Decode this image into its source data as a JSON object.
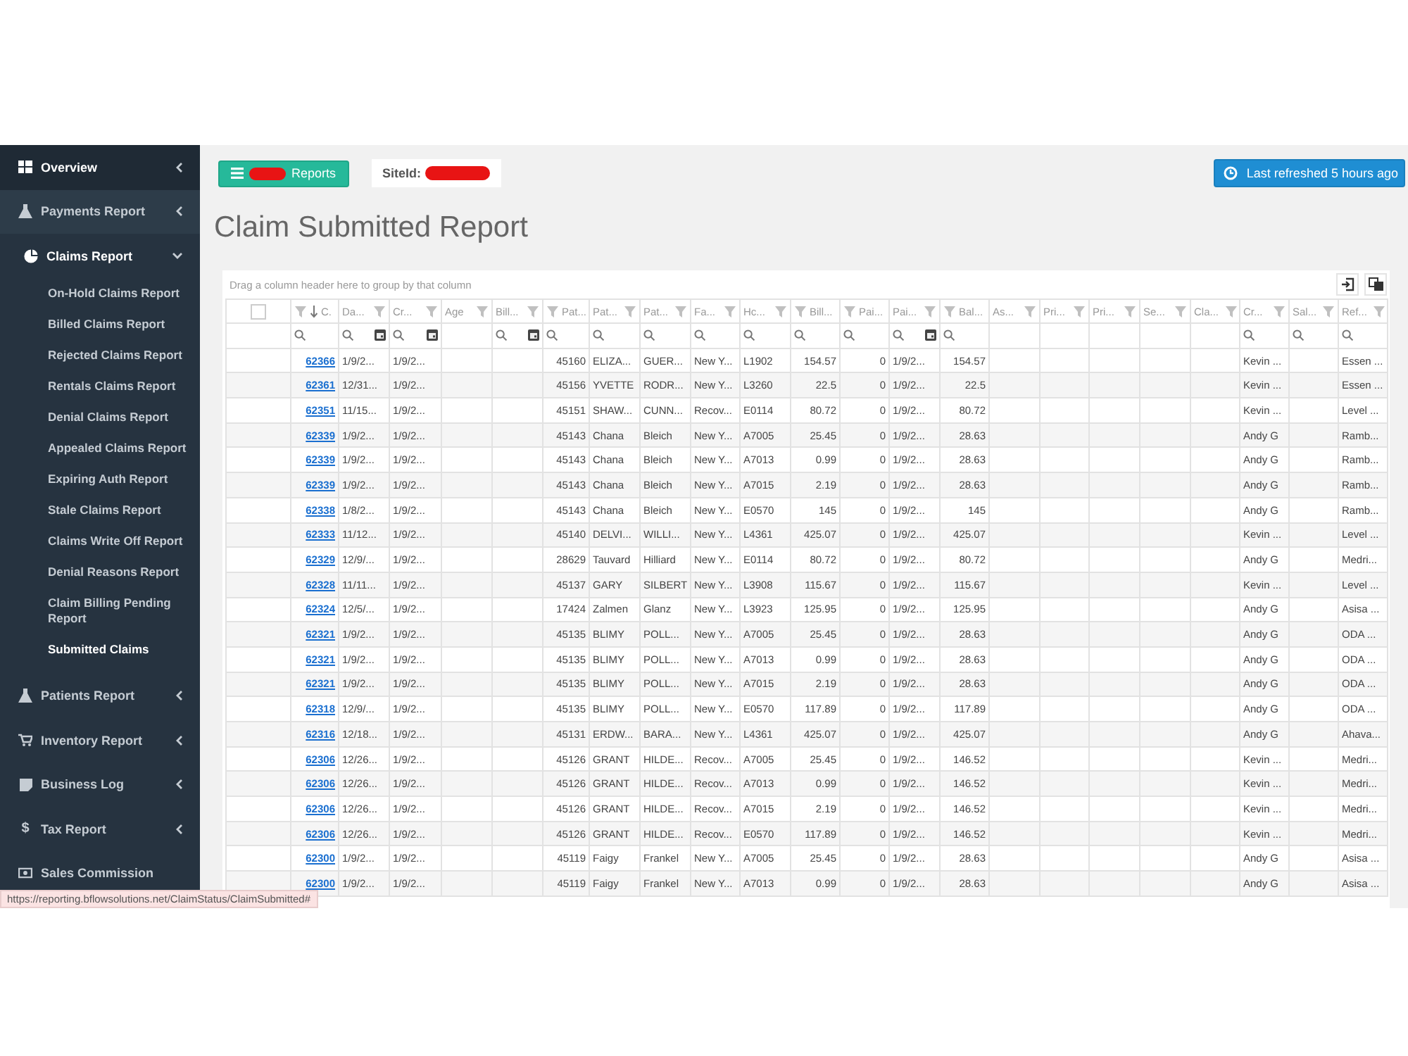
{
  "sidebar": {
    "items": [
      {
        "label": "Overview",
        "expanded": false
      },
      {
        "label": "Payments Report",
        "expanded": false
      },
      {
        "label": "Claims Report",
        "expanded": true,
        "children": [
          {
            "label": "On-Hold Claims Report",
            "selected": false
          },
          {
            "label": "Billed Claims Report",
            "selected": false
          },
          {
            "label": "Rejected Claims Report",
            "selected": false
          },
          {
            "label": "Rentals Claims Report",
            "selected": false
          },
          {
            "label": "Denial Claims Report",
            "selected": false
          },
          {
            "label": "Appealed Claims Report",
            "selected": false
          },
          {
            "label": "Expiring Auth Report",
            "selected": false
          },
          {
            "label": "Stale Claims Report",
            "selected": false
          },
          {
            "label": "Claims Write Off Report",
            "selected": false
          },
          {
            "label": "Denial Reasons Report",
            "selected": false
          },
          {
            "label": "Claim Billing Pending Report",
            "selected": false
          },
          {
            "label": "Submitted Claims",
            "selected": true
          }
        ]
      },
      {
        "label": "Patients Report",
        "expanded": false
      },
      {
        "label": "Inventory Report",
        "expanded": false
      },
      {
        "label": "Business Log",
        "expanded": false
      },
      {
        "label": "Tax Report",
        "glyph": "$",
        "expanded": false
      },
      {
        "label": "Sales Commission"
      }
    ]
  },
  "toolbar": {
    "reports_button": {
      "label": "Reports",
      "redacted": true
    },
    "site_id": {
      "label": "SiteId:",
      "redacted": true
    },
    "refresh_button": {
      "label": "Last refreshed 5 hours ago"
    }
  },
  "title": "Claim Submitted Report",
  "grid": {
    "group_panel": "Drag a column header here to group by that column",
    "columns": [
      {
        "kind": "checkbox",
        "checked": false
      },
      {
        "label": "C.",
        "kind": "link",
        "sorted": true,
        "filterable": true
      },
      {
        "label": "Da...",
        "kind": "date",
        "sorted": false,
        "filterable": true
      },
      {
        "label": "Cr...",
        "kind": "date",
        "sorted": false,
        "filterable": true
      },
      {
        "label": "Age",
        "kind": "text",
        "sorted": false,
        "filterable": false
      },
      {
        "label": "Bill...",
        "kind": "date",
        "sorted": false,
        "filterable": true
      },
      {
        "label": "Pat...",
        "kind": "number",
        "sorted": false,
        "filterable": true
      },
      {
        "label": "Pat...",
        "kind": "text",
        "sorted": false,
        "filterable": true
      },
      {
        "label": "Pat...",
        "kind": "text",
        "sorted": false,
        "filterable": true
      },
      {
        "label": "Fa...",
        "kind": "text",
        "sorted": false,
        "filterable": true
      },
      {
        "label": "Hc...",
        "kind": "text",
        "sorted": false,
        "filterable": true
      },
      {
        "label": "Bill...",
        "kind": "number",
        "sorted": false,
        "filterable": true
      },
      {
        "label": "Pai...",
        "kind": "number",
        "sorted": false,
        "filterable": true
      },
      {
        "label": "Pai...",
        "kind": "date",
        "sorted": false,
        "filterable": true
      },
      {
        "label": "Bal...",
        "kind": "number",
        "sorted": false,
        "filterable": true
      },
      {
        "label": "As...",
        "kind": "text",
        "sorted": false,
        "filterable": false
      },
      {
        "label": "Pri...",
        "kind": "text",
        "sorted": false,
        "filterable": false
      },
      {
        "label": "Pri...",
        "kind": "text",
        "sorted": false,
        "filterable": false
      },
      {
        "label": "Se...",
        "kind": "text",
        "sorted": false,
        "filterable": false
      },
      {
        "label": "Cla...",
        "kind": "text",
        "sorted": false,
        "filterable": false
      },
      {
        "label": "Cr...",
        "kind": "text",
        "sorted": false,
        "filterable": true
      },
      {
        "label": "Sal...",
        "kind": "text",
        "sorted": false,
        "filterable": true
      },
      {
        "label": "Ref...",
        "kind": "text",
        "sorted": false,
        "filterable": true
      }
    ],
    "rows": [
      [
        null,
        "62366",
        "1/9/2...",
        "1/9/2...",
        null,
        null,
        "45160",
        "ELIZA...",
        "GUER...",
        "New Y...",
        "L1902",
        "154.57",
        "0",
        "1/9/2...",
        "154.57",
        null,
        null,
        null,
        null,
        null,
        "Kevin ...",
        null,
        "Essen ..."
      ],
      [
        null,
        "62361",
        "12/31...",
        "1/9/2...",
        null,
        null,
        "45156",
        "YVETTE",
        "RODR...",
        "New Y...",
        "L3260",
        "22.5",
        "0",
        "1/9/2...",
        "22.5",
        null,
        null,
        null,
        null,
        null,
        "Kevin ...",
        null,
        "Essen ..."
      ],
      [
        null,
        "62351",
        "11/15...",
        "1/9/2...",
        null,
        null,
        "45151",
        "SHAW...",
        "CUNN...",
        "Recov...",
        "E0114",
        "80.72",
        "0",
        "1/9/2...",
        "80.72",
        null,
        null,
        null,
        null,
        null,
        "Kevin ...",
        null,
        "Level ..."
      ],
      [
        null,
        "62339",
        "1/9/2...",
        "1/9/2...",
        null,
        null,
        "45143",
        "Chana",
        "Bleich",
        "New Y...",
        "A7005",
        "25.45",
        "0",
        "1/9/2...",
        "28.63",
        null,
        null,
        null,
        null,
        null,
        "Andy G",
        null,
        "Ramb..."
      ],
      [
        null,
        "62339",
        "1/9/2...",
        "1/9/2...",
        null,
        null,
        "45143",
        "Chana",
        "Bleich",
        "New Y...",
        "A7013",
        "0.99",
        "0",
        "1/9/2...",
        "28.63",
        null,
        null,
        null,
        null,
        null,
        "Andy G",
        null,
        "Ramb..."
      ],
      [
        null,
        "62339",
        "1/9/2...",
        "1/9/2...",
        null,
        null,
        "45143",
        "Chana",
        "Bleich",
        "New Y...",
        "A7015",
        "2.19",
        "0",
        "1/9/2...",
        "28.63",
        null,
        null,
        null,
        null,
        null,
        "Andy G",
        null,
        "Ramb..."
      ],
      [
        null,
        "62338",
        "1/8/2...",
        "1/9/2...",
        null,
        null,
        "45143",
        "Chana",
        "Bleich",
        "New Y...",
        "E0570",
        "145",
        "0",
        "1/9/2...",
        "145",
        null,
        null,
        null,
        null,
        null,
        "Andy G",
        null,
        "Ramb..."
      ],
      [
        null,
        "62333",
        "11/12...",
        "1/9/2...",
        null,
        null,
        "45140",
        "DELVI...",
        "WILLI...",
        "New Y...",
        "L4361",
        "425.07",
        "0",
        "1/9/2...",
        "425.07",
        null,
        null,
        null,
        null,
        null,
        "Kevin ...",
        null,
        "Level ..."
      ],
      [
        null,
        "62329",
        "12/9/...",
        "1/9/2...",
        null,
        null,
        "28629",
        "Tauvard",
        "Hilliard",
        "New Y...",
        "E0114",
        "80.72",
        "0",
        "1/9/2...",
        "80.72",
        null,
        null,
        null,
        null,
        null,
        "Andy G",
        null,
        "Medri..."
      ],
      [
        null,
        "62328",
        "11/11...",
        "1/9/2...",
        null,
        null,
        "45137",
        "GARY",
        "SILBERT",
        "New Y...",
        "L3908",
        "115.67",
        "0",
        "1/9/2...",
        "115.67",
        null,
        null,
        null,
        null,
        null,
        "Kevin ...",
        null,
        "Level ..."
      ],
      [
        null,
        "62324",
        "12/5/...",
        "1/9/2...",
        null,
        null,
        "17424",
        "Zalmen",
        "Glanz",
        "New Y...",
        "L3923",
        "125.95",
        "0",
        "1/9/2...",
        "125.95",
        null,
        null,
        null,
        null,
        null,
        "Andy G",
        null,
        "Asisa ..."
      ],
      [
        null,
        "62321",
        "1/9/2...",
        "1/9/2...",
        null,
        null,
        "45135",
        "BLIMY",
        "POLL...",
        "New Y...",
        "A7005",
        "25.45",
        "0",
        "1/9/2...",
        "28.63",
        null,
        null,
        null,
        null,
        null,
        "Andy G",
        null,
        "ODA ..."
      ],
      [
        null,
        "62321",
        "1/9/2...",
        "1/9/2...",
        null,
        null,
        "45135",
        "BLIMY",
        "POLL...",
        "New Y...",
        "A7013",
        "0.99",
        "0",
        "1/9/2...",
        "28.63",
        null,
        null,
        null,
        null,
        null,
        "Andy G",
        null,
        "ODA ..."
      ],
      [
        null,
        "62321",
        "1/9/2...",
        "1/9/2...",
        null,
        null,
        "45135",
        "BLIMY",
        "POLL...",
        "New Y...",
        "A7015",
        "2.19",
        "0",
        "1/9/2...",
        "28.63",
        null,
        null,
        null,
        null,
        null,
        "Andy G",
        null,
        "ODA ..."
      ],
      [
        null,
        "62318",
        "12/9/...",
        "1/9/2...",
        null,
        null,
        "45135",
        "BLIMY",
        "POLL...",
        "New Y...",
        "E0570",
        "117.89",
        "0",
        "1/9/2...",
        "117.89",
        null,
        null,
        null,
        null,
        null,
        "Andy G",
        null,
        "ODA ..."
      ],
      [
        null,
        "62316",
        "12/18...",
        "1/9/2...",
        null,
        null,
        "45131",
        "ERDW...",
        "BARA...",
        "New Y...",
        "L4361",
        "425.07",
        "0",
        "1/9/2...",
        "425.07",
        null,
        null,
        null,
        null,
        null,
        "Andy G",
        null,
        "Ahava..."
      ],
      [
        null,
        "62306",
        "12/26...",
        "1/9/2...",
        null,
        null,
        "45126",
        "GRANT",
        "HILDE...",
        "Recov...",
        "A7005",
        "25.45",
        "0",
        "1/9/2...",
        "146.52",
        null,
        null,
        null,
        null,
        null,
        "Kevin ...",
        null,
        "Medri..."
      ],
      [
        null,
        "62306",
        "12/26...",
        "1/9/2...",
        null,
        null,
        "45126",
        "GRANT",
        "HILDE...",
        "Recov...",
        "A7013",
        "0.99",
        "0",
        "1/9/2...",
        "146.52",
        null,
        null,
        null,
        null,
        null,
        "Kevin ...",
        null,
        "Medri..."
      ],
      [
        null,
        "62306",
        "12/26...",
        "1/9/2...",
        null,
        null,
        "45126",
        "GRANT",
        "HILDE...",
        "Recov...",
        "A7015",
        "2.19",
        "0",
        "1/9/2...",
        "146.52",
        null,
        null,
        null,
        null,
        null,
        "Kevin ...",
        null,
        "Medri..."
      ],
      [
        null,
        "62306",
        "12/26...",
        "1/9/2...",
        null,
        null,
        "45126",
        "GRANT",
        "HILDE...",
        "Recov...",
        "E0570",
        "117.89",
        "0",
        "1/9/2...",
        "146.52",
        null,
        null,
        null,
        null,
        null,
        "Kevin ...",
        null,
        "Medri..."
      ],
      [
        null,
        "62300",
        "1/9/2...",
        "1/9/2...",
        null,
        null,
        "45119",
        "Faigy",
        "Frankel",
        "New Y...",
        "A7005",
        "25.45",
        "0",
        "1/9/2...",
        "28.63",
        null,
        null,
        null,
        null,
        null,
        "Andy G",
        null,
        "Asisa ..."
      ],
      [
        null,
        "62300",
        "1/9/2...",
        "1/9/2...",
        null,
        null,
        "45119",
        "Faigy",
        "Frankel",
        "New Y...",
        "A7013",
        "0.99",
        "0",
        "1/9/2...",
        "28.63",
        null,
        null,
        null,
        null,
        null,
        "Andy G",
        null,
        "Asisa ..."
      ]
    ]
  },
  "status_bar": {
    "url": "https://reporting.bflowsolutions.net/ClaimStatus/ClaimSubmitted#"
  }
}
